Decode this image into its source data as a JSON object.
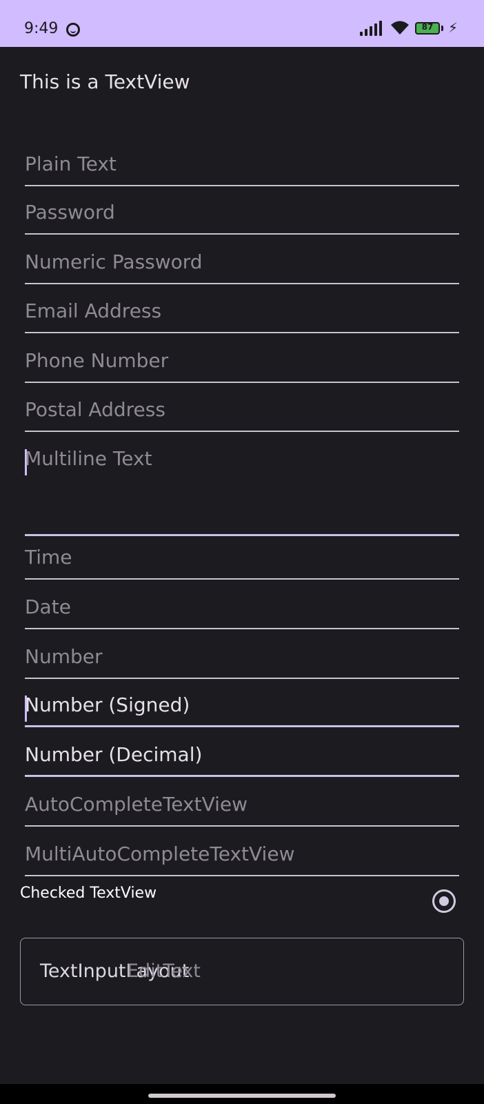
{
  "status_bar": {
    "time": "9:49",
    "battery": "87",
    "icons": [
      "face-icon",
      "signal-icon",
      "wifi-icon",
      "battery-icon",
      "charging-icon"
    ]
  },
  "textview": "This is a TextView",
  "fields": {
    "plain_text": "Plain Text",
    "password": "Password",
    "numeric_password": "Numeric Password",
    "email": "Email Address",
    "phone": "Phone Number",
    "postal": "Postal Address",
    "multiline": "Multiline Text",
    "time": "Time",
    "date": "Date",
    "number": "Number",
    "number_signed": "Number (Signed)",
    "number_decimal": "Number (Decimal)",
    "autocomplete": "AutoCompleteTextView",
    "multi_autocomplete": "MultiAutoCompleteTextView"
  },
  "checked_textview": {
    "label": "Checked TextView",
    "checked": true
  },
  "text_input_layout": {
    "label": "TextInputLayout",
    "hint": "EditText"
  },
  "colors": {
    "status_bar": "#d0bcff",
    "background": "#1c1b20",
    "accent": "#cfbcff"
  }
}
